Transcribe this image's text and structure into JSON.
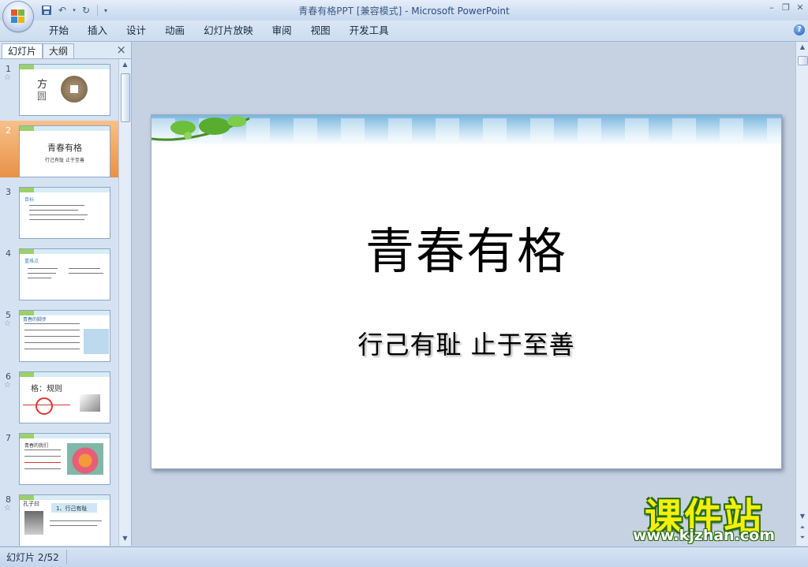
{
  "window": {
    "title_doc": "青春有格PPT [兼容模式]",
    "title_sep": " - ",
    "title_app": "Microsoft PowerPoint"
  },
  "ribbon_tabs": [
    "开始",
    "插入",
    "设计",
    "动画",
    "幻灯片放映",
    "审阅",
    "视图",
    "开发工具"
  ],
  "panel": {
    "tab_slides": "幻灯片",
    "tab_outline": "大纲",
    "close": "×"
  },
  "thumbnails": [
    {
      "num": "1",
      "text1": "方",
      "text2": "圆"
    },
    {
      "num": "2",
      "text1": "青春有格",
      "text2": "行己有耻 止于至善"
    },
    {
      "num": "3",
      "text1": "目标"
    },
    {
      "num": "4",
      "text1": "重难点"
    },
    {
      "num": "5",
      "text1": "青春的脚步"
    },
    {
      "num": "6",
      "text1": "格：规则"
    },
    {
      "num": "7",
      "text1": "青春的我们"
    },
    {
      "num": "8",
      "text1": "孔子曰",
      "text2": "1、行己有耻"
    }
  ],
  "slide": {
    "title": "青春有格",
    "subtitle": "行己有耻 止于至善"
  },
  "status": {
    "slide_indicator": "幻灯片 2/52"
  },
  "watermark": {
    "title": "课件站",
    "url": "www.kjzhan.com"
  },
  "colors": {
    "selected_thumb": "#e99146",
    "watermark_fill": "#f3f10a",
    "watermark_stroke": "#2a6b12"
  }
}
